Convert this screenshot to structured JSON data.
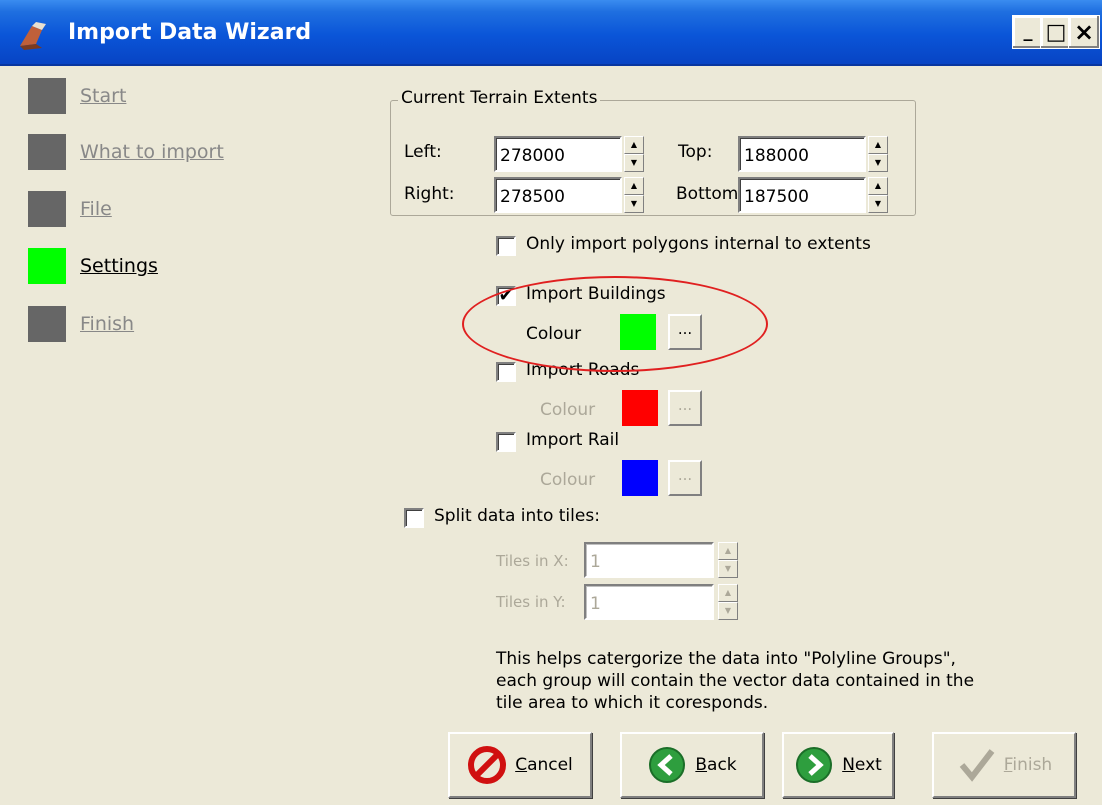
{
  "window": {
    "title": "Import Data Wizard",
    "min_glyph": "_",
    "max_glyph": "□",
    "close_glyph": "×"
  },
  "sidebar": {
    "items": [
      {
        "label": "Start",
        "active": false
      },
      {
        "label": "What to import",
        "active": false
      },
      {
        "label": "File",
        "active": false
      },
      {
        "label": "Settings",
        "active": true
      },
      {
        "label": "Finish",
        "active": false
      }
    ]
  },
  "extents": {
    "title": "Current Terrain Extents",
    "left_label": "Left:",
    "left_value": "278000",
    "right_label": "Right:",
    "right_value": "278500",
    "top_label": "Top:",
    "top_value": "188000",
    "bottom_label": "Bottom",
    "bottom_value": "187500"
  },
  "options": {
    "only_internal": {
      "label": "Only import polygons internal to extents",
      "checked": false
    },
    "buildings": {
      "label": "Import Buildings",
      "checked": true,
      "colour_label": "Colour",
      "colour": "#00ff00"
    },
    "roads": {
      "label": "Import Roads",
      "checked": false,
      "colour_label": "Colour",
      "colour": "#ff0000"
    },
    "rail": {
      "label": "Import Rail",
      "checked": false,
      "colour_label": "Colour",
      "colour": "#0000ff"
    },
    "dots_label": "...",
    "check_glyph": "✔"
  },
  "tiles": {
    "split_label": "Split data into tiles:",
    "split_checked": false,
    "x_label": "Tiles in X:",
    "x_value": "1",
    "y_label": "Tiles in Y:",
    "y_value": "1",
    "help": "This helps catergorize the data into \"Polyline Groups\", each group will contain the vector data contained in the tile area to which it coresponds."
  },
  "buttons": {
    "cancel": {
      "u": "C",
      "rest": "ancel"
    },
    "back": {
      "u": "B",
      "rest": "ack"
    },
    "next": {
      "u": "N",
      "rest": "ext"
    },
    "finish": {
      "u": "F",
      "rest": "inish"
    }
  },
  "colors": {
    "titlebar": "#0a55d8",
    "active_step": "#00ff00",
    "inactive_step": "#666666",
    "annotation": "#e02020"
  }
}
